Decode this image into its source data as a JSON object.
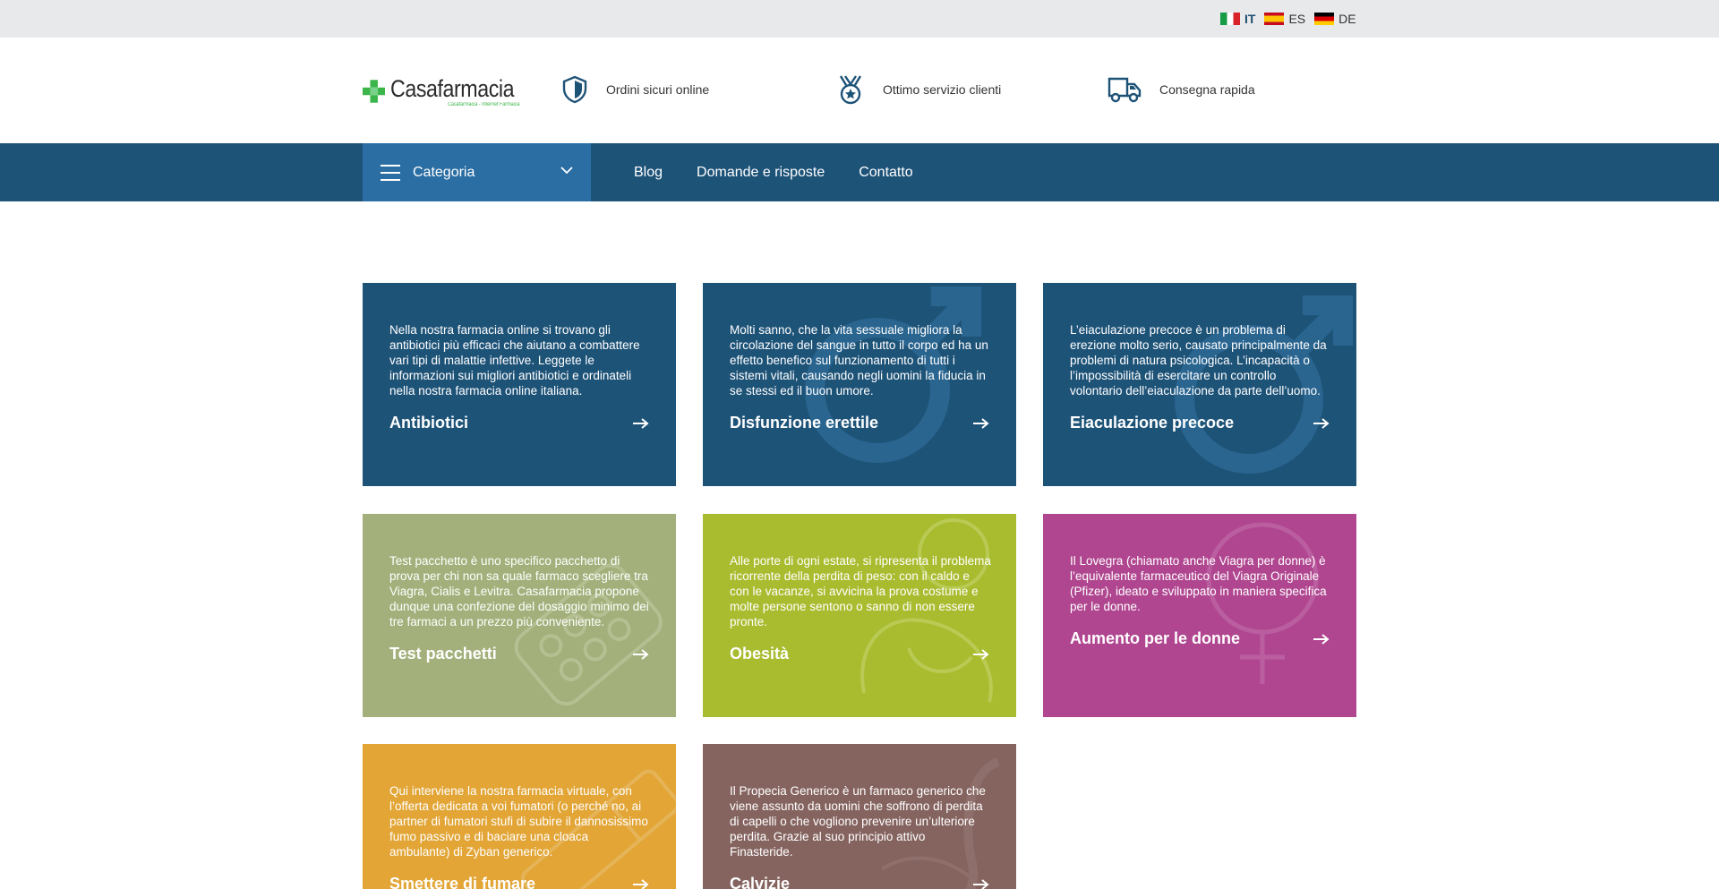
{
  "languages": [
    {
      "code": "IT",
      "flag": "flag-italy",
      "active": true
    },
    {
      "code": "ES",
      "flag": "flag-spain",
      "active": false
    },
    {
      "code": "DE",
      "flag": "flag-germany",
      "active": false
    }
  ],
  "header": {
    "logo_name": "Casafarmacia",
    "logo_sub": "Casafarmacia - Internet Farmacia",
    "features": [
      {
        "icon": "shield-icon",
        "label": "Ordini sicuri online"
      },
      {
        "icon": "medal-icon",
        "label": "Ottimo servizio clienti"
      },
      {
        "icon": "truck-icon",
        "label": "Consegna rapida"
      }
    ]
  },
  "nav": {
    "category_label": "Categoria",
    "links": [
      "Blog",
      "Domande e risposte",
      "Contatto"
    ]
  },
  "colors": {
    "brand_blue": "#1e5378",
    "category_blue": "#2b6ea3",
    "logo_green": "#3cb54a",
    "card_olive": "#a3b07b",
    "card_lime": "#a9bc2f",
    "card_pink": "#b04690",
    "card_orange": "#e2a536",
    "card_brown": "#856460"
  },
  "cards": [
    {
      "title": "Antibiotici",
      "text": "Nella nostra farmacia online si trovano gli antibiotici più efficaci che aiutano a combattere vari tipi di malattie infettive. Leggete le informazioni sui migliori antibiotici e ordinateli nella nostra farmacia online italiana."
    },
    {
      "title": "Disfunzione erettile",
      "text": "Molti sanno, che la vita sessuale migliora la circolazione del sangue in tutto il corpo ed ha un effetto benefico sul funzionamento di tutti i sistemi vitali, causando negli uomini la fiducia in se stessi ed il buon umore."
    },
    {
      "title": "Eiaculazione precoce",
      "text": "L’eiaculazione precoce è un problema di erezione molto serio, causato principalmente da problemi di natura psicologica. L’incapacità o l’impossibilità di esercitare un controllo volontario dell’eiaculazione da parte dell’uomo."
    },
    {
      "title": "Test pacchetti",
      "text": "Test pacchetto è uno specifico pacchetto di prova per chi non sa quale farmaco scegliere tra Viagra, Cialis e Levitra. Casafarmacia propone dunque una confezione del dosaggio minimo dei tre farmaci a un prezzo più conveniente."
    },
    {
      "title": "Obesità",
      "text": "Alle porte di ogni estate, si ripresenta il problema ricorrente della perdita di peso: con il caldo e con le vacanze, si avvicina la prova costume e molte persone sentono o sanno di non essere pronte."
    },
    {
      "title": "Aumento per le donne",
      "text": "Il Lovegra (chiamato anche Viagra per donne) è l’equivalente farmaceutico del Viagra Originale (Pfizer), ideato e sviluppato in maniera specifica per le donne."
    },
    {
      "title": "Smettere di fumare",
      "text": "Qui interviene la nostra farmacia virtuale, con l’offerta dedicata a voi fumatori (o perché no, ai partner di fumatori stufi di subire il dannosissimo fumo passivo e di baciare una cloaca ambulante) di Zyban generico."
    },
    {
      "title": "Calvizie",
      "text": "Il Propecia Generico è un farmaco generico che viene assunto da uomini che soffrono di perdita di capelli o che vogliono prevenire un’ulteriore perdita. Grazie al suo principio attivo Finasteride."
    }
  ]
}
